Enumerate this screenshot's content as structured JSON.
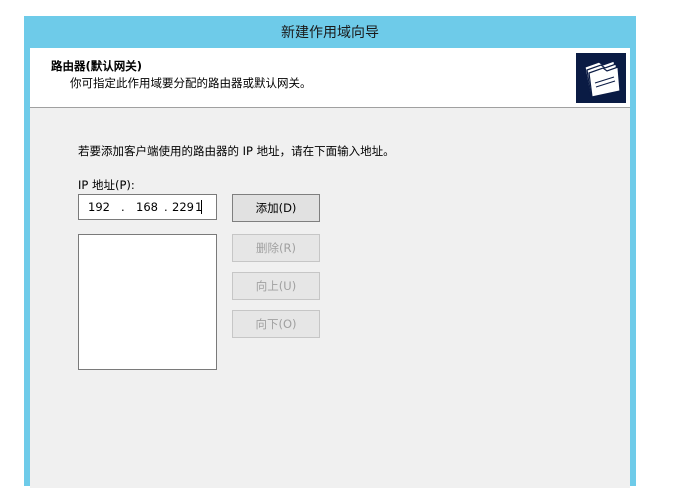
{
  "window": {
    "title": "新建作用域向导"
  },
  "header": {
    "title": "路由器(默认网关)",
    "subtitle": "你可指定此作用域要分配的路由器或默认网关。",
    "icon": "folder-stack-icon"
  },
  "body": {
    "instruction": "若要添加客户端使用的路由器的 IP 地址，请在下面输入地址。",
    "ip_label": "IP 地址(P):",
    "ip_octets": [
      "192",
      "168",
      "229",
      "1"
    ],
    "ip_dots": [
      ".",
      ".",
      "."
    ]
  },
  "buttons": {
    "add": "添加(D)",
    "delete": "删除(R)",
    "up": "向上(U)",
    "down": "向下(O)"
  },
  "router_list": [],
  "colors": {
    "titlebar": "#6ecbe9",
    "client": "#f0f0f0",
    "icon_bg": "#0a1b44"
  }
}
